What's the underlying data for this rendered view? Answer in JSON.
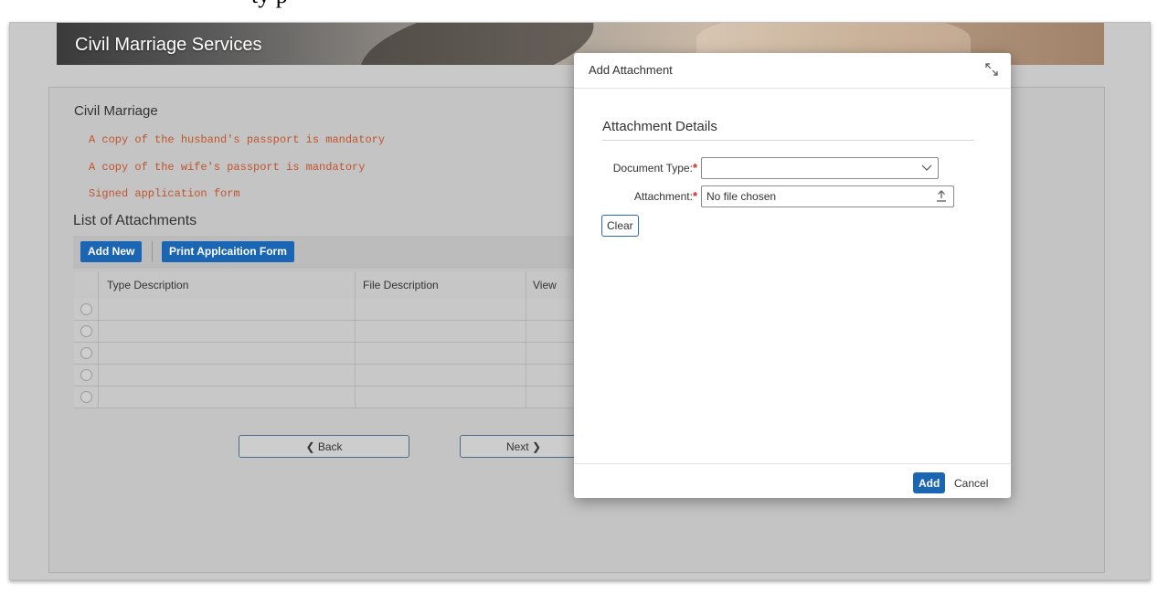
{
  "caption": "ty p",
  "header": {
    "title": "Civil Marriage Services"
  },
  "section": {
    "title": "Civil Marriage",
    "requirements": [
      "A copy of the husband's passport is mandatory",
      "A copy of the wife's passport is mandatory",
      "Signed application form"
    ]
  },
  "attachments": {
    "title": "List of Attachments",
    "add_new_label": "Add New",
    "print_label": "Print Applcaition Form",
    "columns": [
      "Type Description",
      "File Description",
      "View"
    ]
  },
  "nav": {
    "back_label": "❮ Back",
    "next_label": "Next ❯"
  },
  "dialog": {
    "title": "Add Attachment",
    "details_title": "Attachment Details",
    "document_type_label": "Document Type:",
    "document_type_value": "",
    "attachment_label": "Attachment:",
    "file_value": "No file chosen",
    "clear_label": "Clear",
    "add_label": "Add",
    "cancel_label": "Cancel"
  },
  "colors": {
    "accent": "#1a66b5",
    "required": "#d0271d",
    "requirement_text": "#c0552e"
  }
}
